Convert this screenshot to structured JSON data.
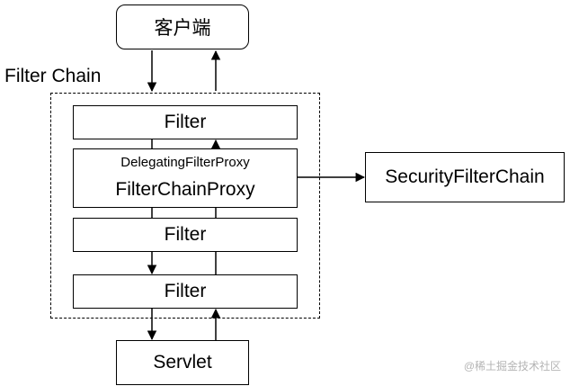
{
  "client": {
    "label": "客户端"
  },
  "filter_chain": {
    "label": "Filter Chain",
    "filters": [
      "Filter",
      "Filter",
      "Filter"
    ],
    "proxy": {
      "small_label": "DelegatingFilterProxy",
      "main_label": "FilterChainProxy"
    }
  },
  "security_filter_chain": {
    "label": "SecurityFilterChain"
  },
  "servlet": {
    "label": "Servlet"
  },
  "watermark": "@稀土掘金技术社区",
  "colors": {
    "stroke": "#000000",
    "background": "#ffffff",
    "watermark": "#b4b4b4"
  }
}
